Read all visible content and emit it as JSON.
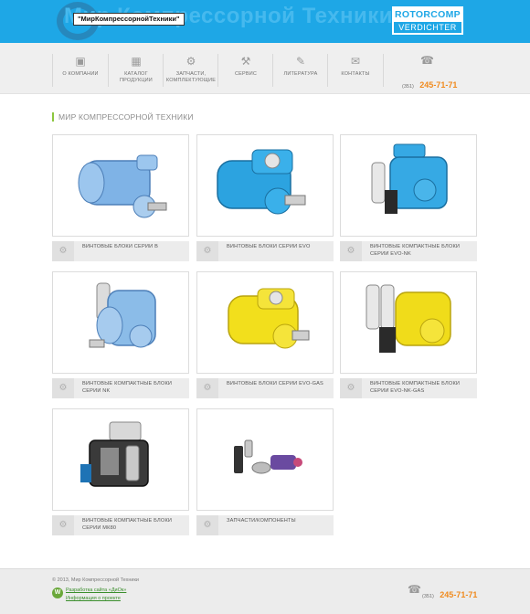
{
  "header": {
    "logo_badge": "\"МирКомпрессорнойТехники\"",
    "bg_text": "Мир Компрессорной Техники",
    "partner_logo_top": "ROTORCOMP",
    "partner_logo_bottom": "VERDICHTER"
  },
  "nav": {
    "items": [
      {
        "label": "О КОМПАНИИ",
        "icon": "briefcase-icon"
      },
      {
        "label": "КАТАЛОГ ПРОДУКЦИИ",
        "icon": "book-icon"
      },
      {
        "label": "ЗАПЧАСТИ, КОМПЛЕКТУЮЩИЕ",
        "icon": "gears-icon"
      },
      {
        "label": "СЕРВИС",
        "icon": "wrench-icon"
      },
      {
        "label": "ЛИТЕРАТУРА",
        "icon": "pen-icon"
      },
      {
        "label": "КОНТАКТЫ",
        "icon": "mail-icon"
      }
    ],
    "phone_code": "(351)",
    "phone_number": "245-71-71"
  },
  "section_title": "МИР КОМПРЕССОРНОЙ ТЕХНИКИ",
  "products": [
    {
      "caption": "ВИНТОВЫЕ БЛОКИ СЕРИИ В",
      "color": "#7fb3e6"
    },
    {
      "caption": "ВИНТОВЫЕ БЛОКИ СЕРИИ EVO",
      "color": "#2ca3e0"
    },
    {
      "caption": "ВИНТОВЫЕ КОМПАКТНЫЕ БЛОКИ СЕРИИ EVO-NK",
      "color": "#36a9e4"
    },
    {
      "caption": "ВИНТОВЫЕ КОМПАКТНЫЕ БЛОКИ СЕРИИ NK",
      "color": "#8bbce8"
    },
    {
      "caption": "ВИНТОВЫЕ БЛОКИ СЕРИИ EVO-GAS",
      "color": "#f2df1c"
    },
    {
      "caption": "ВИНТОВЫЕ КОМПАКТНЫЕ БЛОКИ СЕРИИ EVO-NK-GAS",
      "color": "#f0dc1a"
    },
    {
      "caption": "ВИНТОВЫЕ КОМПАКТНЫЕ БЛОКИ СЕРИИ МК80",
      "color": "#3a3a3a"
    },
    {
      "caption": "ЗАПЧАСТИ/КОМПОНЕНТЫ",
      "color": "#6a4aa0"
    }
  ],
  "footer": {
    "copyright": "© 2013, Мир Компрессорной Техники",
    "developer_link": "Разработка сайта «ДиОк»",
    "info_link": "Информация о проекте",
    "phone_code": "(351)",
    "phone_number": "245-71-71"
  },
  "colors": {
    "header_bg": "#1ea7e6",
    "accent_green": "#8cc63f",
    "phone_orange": "#f08a1d"
  }
}
